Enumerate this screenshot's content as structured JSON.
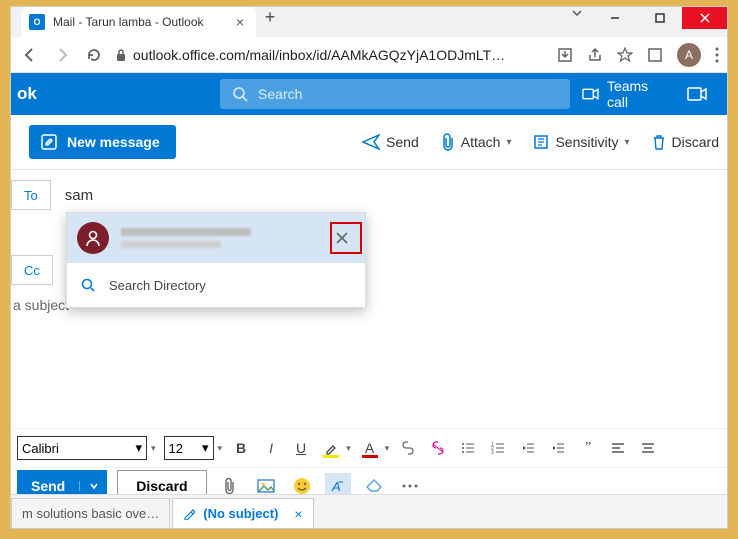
{
  "browser": {
    "tab_title": "Mail - Tarun lamba - Outlook",
    "url": "outlook.office.com/mail/inbox/id/AAMkAGQzYjA1ODJmLT…",
    "avatar_letter": "A"
  },
  "app": {
    "brand": "ok",
    "search_placeholder": "Search",
    "teams_call": "Teams call"
  },
  "commands": {
    "new_message": "New message",
    "send": "Send",
    "attach": "Attach",
    "sensitivity": "Sensitivity",
    "discard": "Discard"
  },
  "compose": {
    "to_label": "To",
    "to_value": "sam",
    "cc_label": "Cc",
    "subject_placeholder": "a subject"
  },
  "suggestion": {
    "search_directory": "Search Directory"
  },
  "format": {
    "font": "Calibri",
    "size": "12"
  },
  "bottom": {
    "send": "Send",
    "discard": "Discard"
  },
  "tabs": {
    "prev": "m solutions basic ove…",
    "current": "(No subject)"
  }
}
